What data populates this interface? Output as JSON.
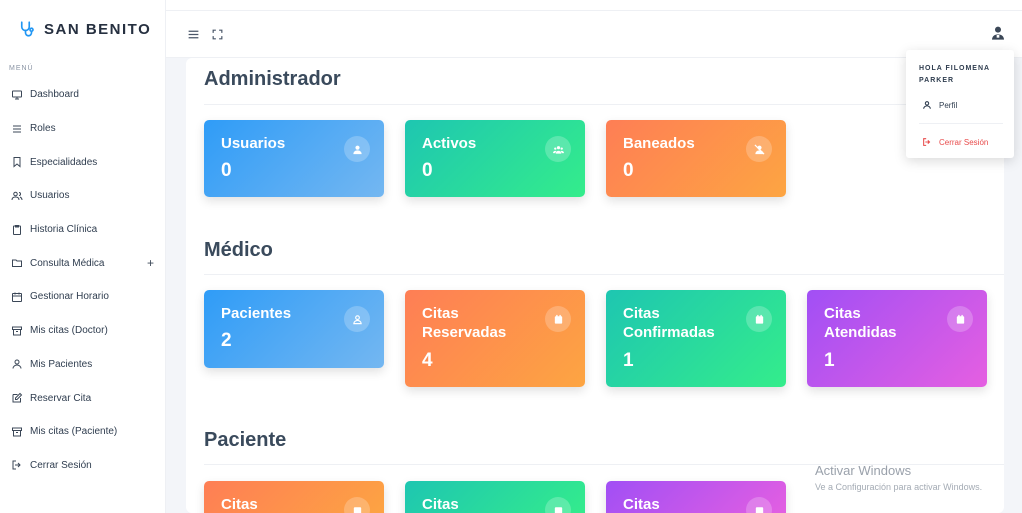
{
  "brand": {
    "name": "SAN BENITO"
  },
  "sidebar": {
    "menu_label": "MENÚ",
    "items": [
      {
        "label": "Dashboard"
      },
      {
        "label": "Roles"
      },
      {
        "label": "Especialidades"
      },
      {
        "label": "Usuarios"
      },
      {
        "label": "Historia Clínica"
      },
      {
        "label": "Consulta Médica",
        "expand": "+"
      },
      {
        "label": "Gestionar Horario"
      },
      {
        "label": "Mis citas (Doctor)"
      },
      {
        "label": "Mis Pacientes"
      },
      {
        "label": "Reservar Cita"
      },
      {
        "label": "Mis citas (Paciente)"
      },
      {
        "label": "Cerrar Sesión"
      }
    ]
  },
  "sections": {
    "admin": {
      "title": "Administrador",
      "cards": [
        {
          "title": "Usuarios",
          "value": "0"
        },
        {
          "title": "Activos",
          "value": "0"
        },
        {
          "title": "Baneados",
          "value": "0"
        }
      ]
    },
    "medico": {
      "title": "Médico",
      "cards": [
        {
          "title": "Pacientes",
          "value": "2"
        },
        {
          "title": "Citas Reservadas",
          "value": "4"
        },
        {
          "title": "Citas Confirmadas",
          "value": "1"
        },
        {
          "title": "Citas Atendidas",
          "value": "1"
        }
      ]
    },
    "paciente": {
      "title": "Paciente",
      "cards": [
        {
          "title": "Citas"
        },
        {
          "title": "Citas"
        },
        {
          "title": "Citas"
        }
      ]
    }
  },
  "user_menu": {
    "greeting": "HOLA FILOMENA PARKER",
    "profile": "Perfil",
    "logout": "Cerrar Sesión"
  },
  "watermark": {
    "title": "Activar Windows",
    "subtitle": "Ve a Configuración para activar Windows."
  },
  "colors": {
    "brand_icon": "#2196f3",
    "blue": "#2f9cf7",
    "green": "#1ec6b1",
    "orange": "#fe7e55",
    "purple": "#a14ff5",
    "logout": "#e84b4b"
  }
}
